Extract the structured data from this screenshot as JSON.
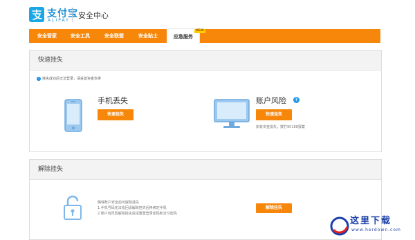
{
  "header": {
    "logo_cn": "支付宝",
    "logo_en": "ALIPAY",
    "site_title": "安全中心"
  },
  "nav": {
    "items": [
      {
        "label": "安全管家"
      },
      {
        "label": "安全工具"
      },
      {
        "label": "安全联盟"
      },
      {
        "label": "安全贴士"
      },
      {
        "label": "应急服务",
        "active": true
      }
    ],
    "badge": "NEW"
  },
  "quick_freeze": {
    "title": "快速挂失",
    "tip": "挂失成功后无法登录，请妥善资金安排",
    "phone": {
      "title": "手机丢失",
      "button": "快速挂失"
    },
    "account": {
      "title": "账户风险",
      "button": "快速挂失",
      "note": "如有资金损失，拨打95188报案"
    }
  },
  "unfreeze": {
    "title": "解除挂失",
    "lines": [
      "确保账户安全后可解除挂失",
      "1.手机号码无法找回请解除挂失后换绑定手机",
      "2.账户有风险解除挂失后请重置登录密码和支付密码"
    ],
    "button": "解除挂失"
  },
  "watermark": {
    "cn": "这里下载",
    "en": "www.herdown.com"
  },
  "colors": {
    "brand_orange": "#f7870a",
    "alipay_blue": "#1ba7e5",
    "icon_blue": "#7fb8e8"
  }
}
